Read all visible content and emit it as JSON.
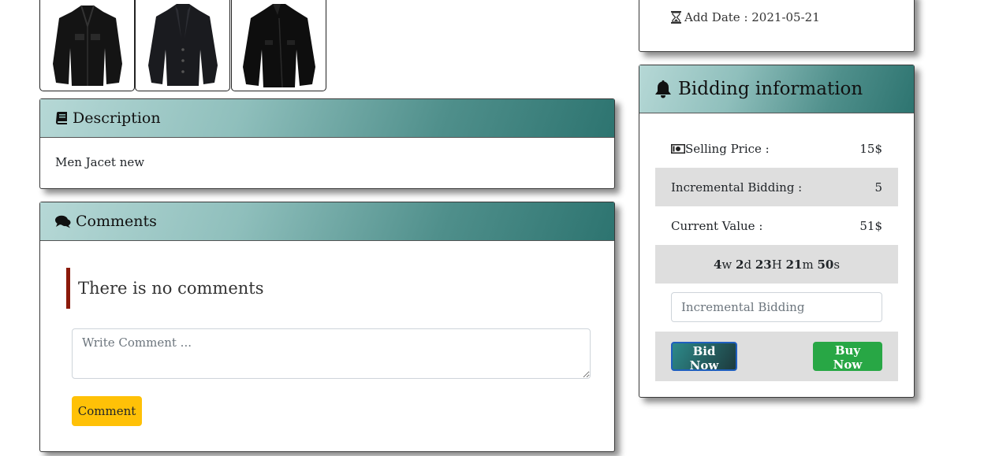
{
  "gallery": {
    "images": [
      {
        "icon": "jacket-image"
      },
      {
        "icon": "jacket-image"
      },
      {
        "icon": "jacket-image"
      }
    ]
  },
  "description": {
    "title": "Description",
    "icon": "book-icon",
    "text": "Men Jacet new"
  },
  "comments": {
    "title": "Comments",
    "icon": "comments-icon",
    "empty_text": "There is no comments",
    "input_placeholder": "Write Comment ...",
    "submit_label": "Comment"
  },
  "info": {
    "add_date_icon": "hourglass-icon",
    "add_date_label": "Add Date : 2021-05-21"
  },
  "bidding": {
    "title": "Bidding information",
    "icon": "bell-icon",
    "selling_price_icon": "money-bill-icon",
    "selling_price_label": "Selling Price :",
    "selling_price_value": "15$",
    "incremental_label": "Incremental Bidding :",
    "incremental_value": "5",
    "current_label": "Current Value :",
    "current_value": "51$",
    "countdown": {
      "weeks": "4",
      "weeks_unit": "w",
      "days": "2",
      "days_unit": "d",
      "hours": "23",
      "hours_unit": "H",
      "minutes": "21",
      "minutes_unit": "m",
      "seconds": "50",
      "seconds_unit": "s"
    },
    "input_placeholder": "Incremental Bidding",
    "bid_now_label": "Bid Now",
    "buy_now_label": "Buy Now"
  },
  "colors": {
    "header_gradient_start": "#b6d8d6",
    "header_gradient_end": "#2d7470",
    "comment_button": "#ffc107",
    "buy_button": "#28a745",
    "quote_border": "#8b1a0a"
  }
}
